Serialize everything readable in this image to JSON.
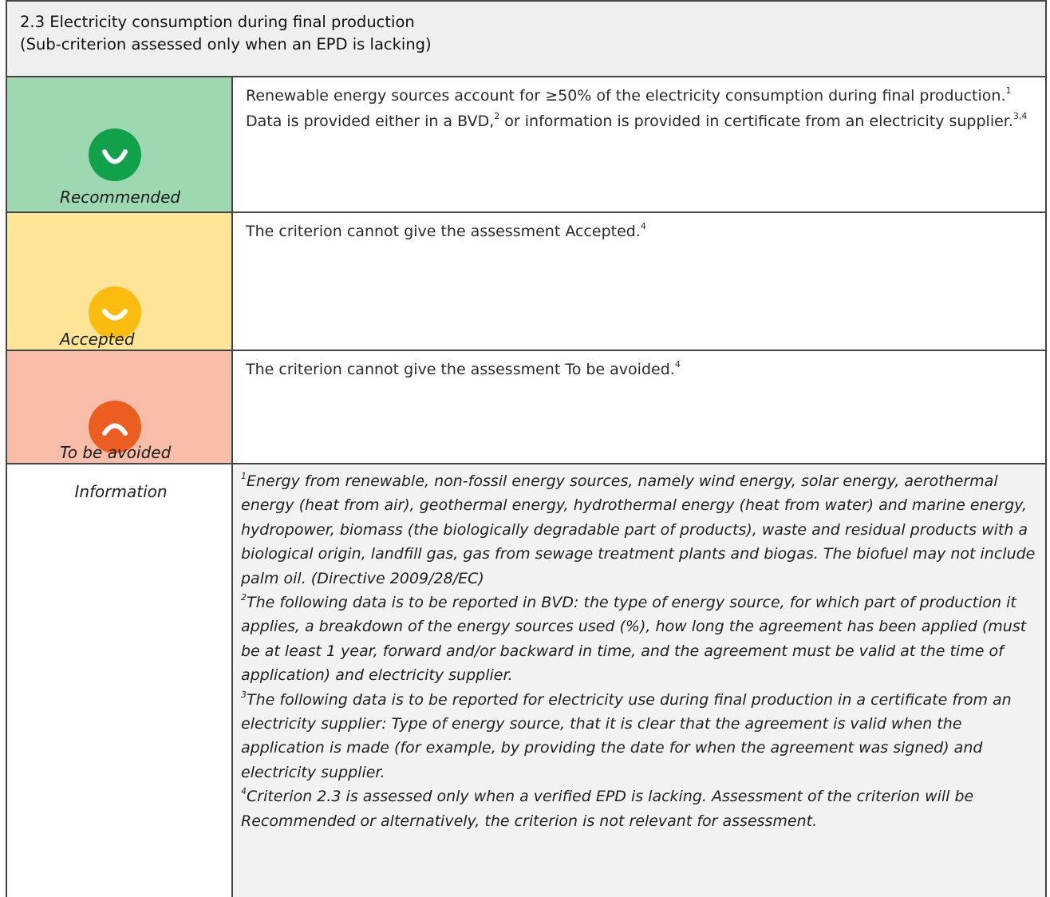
{
  "header": {
    "title_line1": "2.3 Electricity consumption during final production",
    "title_line2": "(Sub-criterion assessed only when an EPD is lacking)"
  },
  "colors": {
    "recommended_bg": "#9ed8b2",
    "recommended_face": "#11a14a",
    "accepted_bg": "#fde497",
    "accepted_face": "#fbbc0f",
    "avoided_bg": "#f7bda8",
    "avoided_face": "#ec5d22",
    "information_bg": "#f2f2f2"
  },
  "ratings": {
    "recommended": {
      "icon": "smiley-happy-icon",
      "label": "Recommended",
      "text_a": "Renewable energy sources account for ≥50% of the electricity consumption during final production.",
      "sup_1": "1",
      "text_b": " Data is provided either in a BVD,",
      "sup_2": "2",
      "text_c": " or information is provided in certificate from an electricity supplier.",
      "sup_3": "3,4"
    },
    "accepted": {
      "icon": "smiley-happy-icon",
      "label": "Accepted",
      "text": "The criterion cannot give the assessment Accepted.",
      "sup": "4"
    },
    "avoided": {
      "icon": "smiley-sad-icon",
      "label": "To be avoided",
      "text": "The criterion cannot give the assessment To be avoided.",
      "sup": "4"
    }
  },
  "information": {
    "label": "Information",
    "footnotes": [
      {
        "num": "1",
        "text": "Energy from renewable, non-fossil energy sources, namely wind energy, solar energy, aerothermal energy (heat from air), geothermal energy, hydrothermal energy (heat from water) and marine energy, hydropower, biomass (the biologically degradable part of products), waste and residual products with a biological origin, landfill gas, gas from sewage treatment plants and biogas. The biofuel may not include palm oil. (Directive 2009/28/EC)"
      },
      {
        "num": "2",
        "text": "The following data is to be reported in BVD: the type of energy source, for which part of production it applies, a breakdown of the energy sources used (%), how long the agreement has been applied (must be at least 1 year, forward and/or backward in time, and the agreement must be valid at the time of application) and electricity supplier."
      },
      {
        "num": "3",
        "text": "The following data is to be reported for electricity use during final production in a certificate from an electricity supplier: Type of energy source, that it is clear that the agreement is valid when the application is made (for example, by providing the date for when the agreement was signed) and electricity supplier."
      },
      {
        "num": "4",
        "text": "Criterion 2.3 is assessed only when a verified EPD is lacking. Assessment of the criterion will be Recommended or alternatively, the criterion is not relevant for assessment."
      }
    ]
  }
}
